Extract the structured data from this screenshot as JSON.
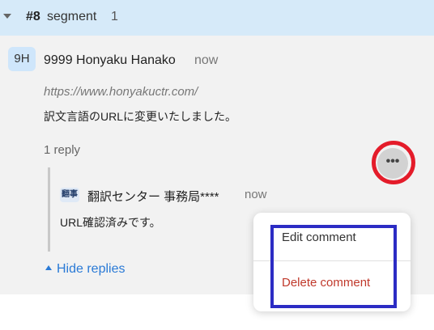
{
  "segment": {
    "number": "#8",
    "label": "segment",
    "count": "1"
  },
  "comment": {
    "avatar_initials": "9H",
    "author": "9999 Honyaku Hanako",
    "time": "now",
    "url": "https://www.honyakuctr.com/",
    "body": "訳文言語のURLに変更いたしました。",
    "reply_count": "1 reply"
  },
  "reply": {
    "avatar_text": "翻事",
    "author": "翻訳センター 事務局****",
    "time": "now",
    "body": "URL確認済みです。",
    "more_label": "•••"
  },
  "hide_replies_label": "Hide replies",
  "menu": {
    "edit_label": "Edit comment",
    "delete_label": "Delete comment"
  },
  "colors": {
    "header_bg": "#d6eaf9",
    "link": "#2a7ad6",
    "danger": "#c0392b",
    "highlight_ring": "#e41c2a",
    "highlight_box": "#2c2cc4"
  }
}
